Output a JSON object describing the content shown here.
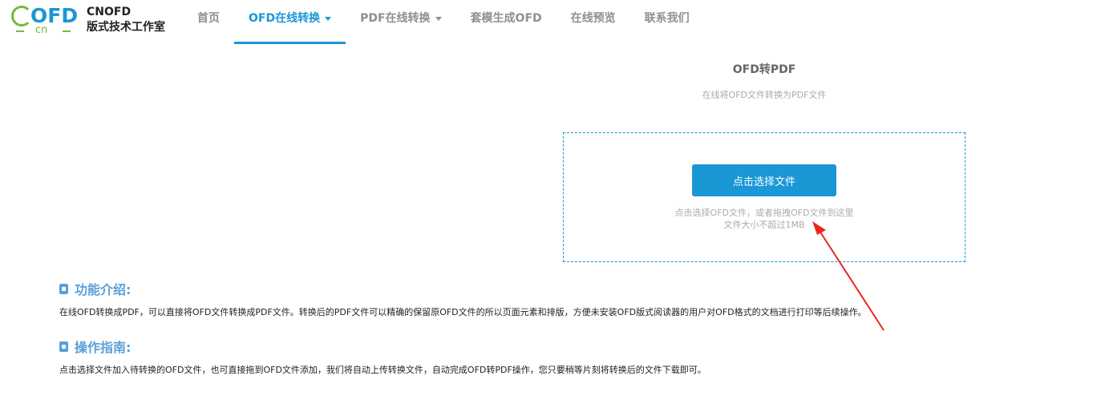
{
  "logo": {
    "brand_text": "OFD",
    "brand_sub": "cn"
  },
  "brand": {
    "name": "CNOFD",
    "subtitle": "版式技术工作室"
  },
  "nav": {
    "items": [
      {
        "label": "首页"
      },
      {
        "label": "OFD在线转换"
      },
      {
        "label": "PDF在线转换"
      },
      {
        "label": "套模生成OFD"
      },
      {
        "label": "在线预览"
      },
      {
        "label": "联系我们"
      }
    ]
  },
  "converter": {
    "title": "OFD转PDF",
    "subtitle": "在线将OFD文件转换为PDF文件",
    "button_label": "点击选择文件",
    "hint_line1": "点击选择OFD文件，或者拖拽OFD文件到这里",
    "hint_line2": "文件大小不超过1MB"
  },
  "intro": {
    "heading": "功能介绍:",
    "text": "在线OFD转换成PDF，可以直接将OFD文件转换成PDF文件。转换后的PDF文件可以精确的保留原OFD文件的所以页面元素和排版，方便未安装OFD版式阅读器的用户对OFD格式的文档进行打印等后续操作。"
  },
  "guide": {
    "heading": "操作指南:",
    "text": "点击选择文件加入待转换的OFD文件，也可直接拖到OFD文件添加，我们将自动上传转换文件，自动完成OFD转PDF操作，您只要稍等片刻将转换后的文件下载即可。"
  },
  "colors": {
    "accent": "#1a97d4",
    "logo_green": "#77b83a",
    "section_heading": "#5aa0d8",
    "annotation_arrow": "#e8281e"
  }
}
